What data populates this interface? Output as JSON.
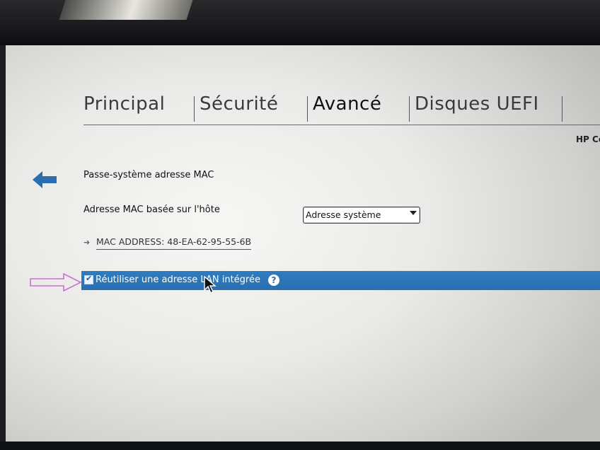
{
  "tabs": [
    {
      "label": "Principal",
      "active": false
    },
    {
      "label": "Sécurité",
      "active": false
    },
    {
      "label": "Avancé",
      "active": true
    },
    {
      "label": "Disques UEFI",
      "active": false
    }
  ],
  "hp_label": "HP Co",
  "settings": {
    "mac_passthrough_label": "Passe-système adresse MAC",
    "host_mac_label": "Adresse MAC basée sur l'hôte",
    "host_mac_dropdown_value": "Adresse système",
    "mac_address_text": "MAC ADDRESS: 48-EA-62-95-55-6B",
    "reuse_lan_label": "Réutiliser une adresse LAN intégrée",
    "reuse_lan_checked": true,
    "help_glyph": "?"
  },
  "colors": {
    "highlight": "#2a6fae",
    "back_arrow": "#2c6db0",
    "annotation_arrow": "#c872cc"
  },
  "icons": {
    "back": "back-arrow-icon",
    "help": "help-icon",
    "cursor": "mouse-cursor-icon",
    "annotation": "annotation-arrow-icon"
  }
}
